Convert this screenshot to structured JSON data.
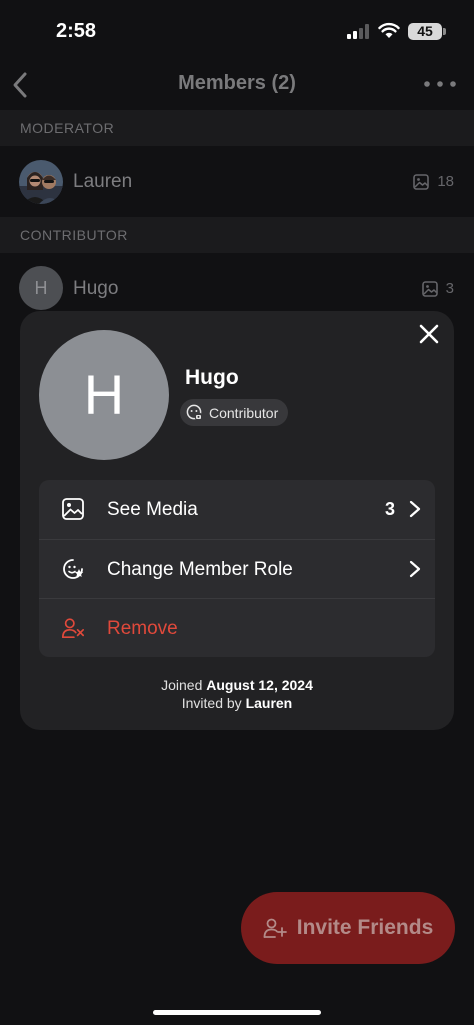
{
  "status": {
    "time": "2:58",
    "battery": "45"
  },
  "nav": {
    "title": "Members (2)"
  },
  "sections": {
    "moderator": "MODERATOR",
    "contributor": "CONTRIBUTOR"
  },
  "members": [
    {
      "name": "Lauren",
      "media_count": "18"
    },
    {
      "name": "Hugo",
      "avatar_initial": "H",
      "media_count": "3"
    }
  ],
  "sheet": {
    "avatar_initial": "H",
    "name": "Hugo",
    "role": "Contributor",
    "menu": {
      "see_media": {
        "label": "See Media",
        "count": "3"
      },
      "change_role": {
        "label": "Change Member Role"
      },
      "remove": {
        "label": "Remove"
      }
    },
    "joined_prefix": "Joined",
    "joined_date": "August 12, 2024",
    "invited_prefix": "Invited by",
    "invited_by": "Lauren"
  },
  "invite_button": {
    "label": "Invite Friends"
  },
  "colors": {
    "danger": "#e0493b",
    "invite_bg": "#7a1c1c",
    "sheet_bg": "#222224"
  }
}
